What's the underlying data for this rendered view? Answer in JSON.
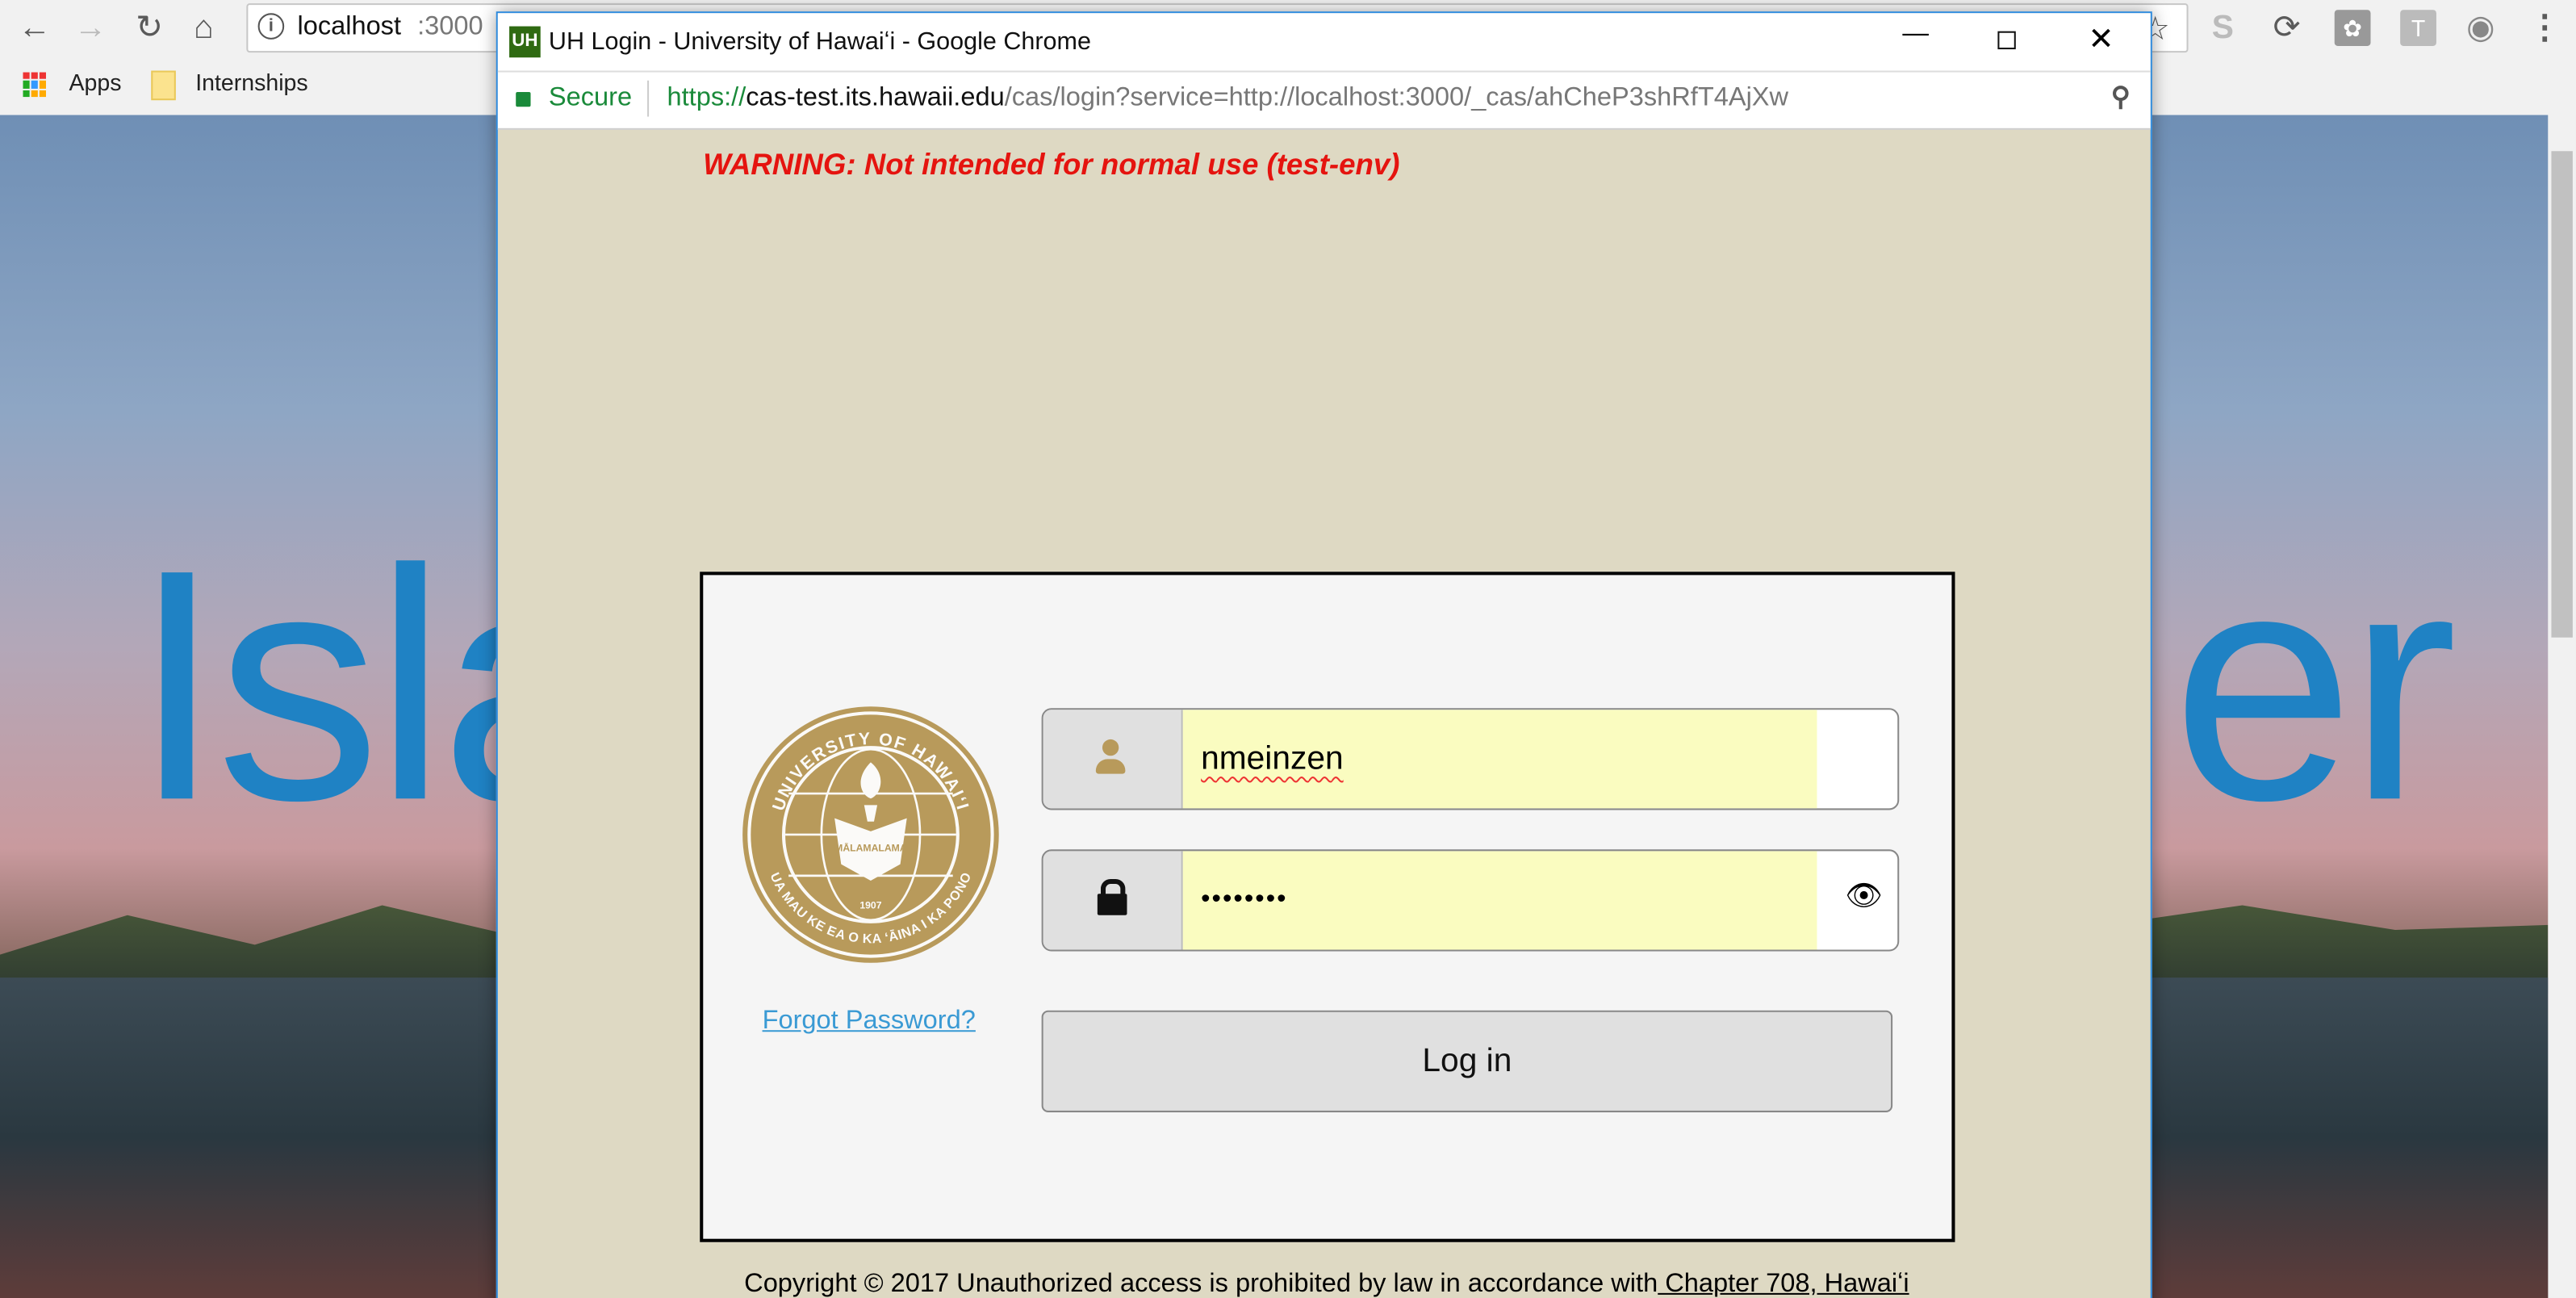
{
  "browser": {
    "address": {
      "host": "localhost",
      "port": ":3000"
    },
    "bookmarks": [
      {
        "label": "Apps"
      },
      {
        "label": "Internships"
      }
    ],
    "extension_icons": [
      "skype-icon",
      "sync-icon",
      "flame-icon",
      "t-icon",
      "camera-icon"
    ]
  },
  "background_page": {
    "word_left": "Isla",
    "word_right": "er",
    "accent": "#1f82c4"
  },
  "popup": {
    "favicon": "UH",
    "title": "UH Login - University of Hawaiʻi - Google Chrome",
    "secure_label": "Secure",
    "url_scheme": "https://",
    "url_host": "cas-test.its.hawaii.edu",
    "url_path": "/cas/login?service=http://localhost:3000/_cas/ahCheP3shRfT4AjXw",
    "warning": "WARNING: Not intended for normal use (test-env)",
    "seal": {
      "top_text": "UNIVERSITY OF HAWAIʻI",
      "bottom_text": "UA MAU KE EA O KA ʻĀINA I KA PONO",
      "motto": "MĀLAMALAMA",
      "year": "1907",
      "color": "#b89a5b"
    },
    "username": "nmeinzen",
    "password_masked": "••••••••",
    "forgot_password": "Forgot Password?",
    "login_button": "Log in",
    "copyright": "Copyright © 2017 Unauthorized access is prohibited by law in accordance with",
    "copyright_link": " Chapter 708, Hawaiʻi"
  }
}
